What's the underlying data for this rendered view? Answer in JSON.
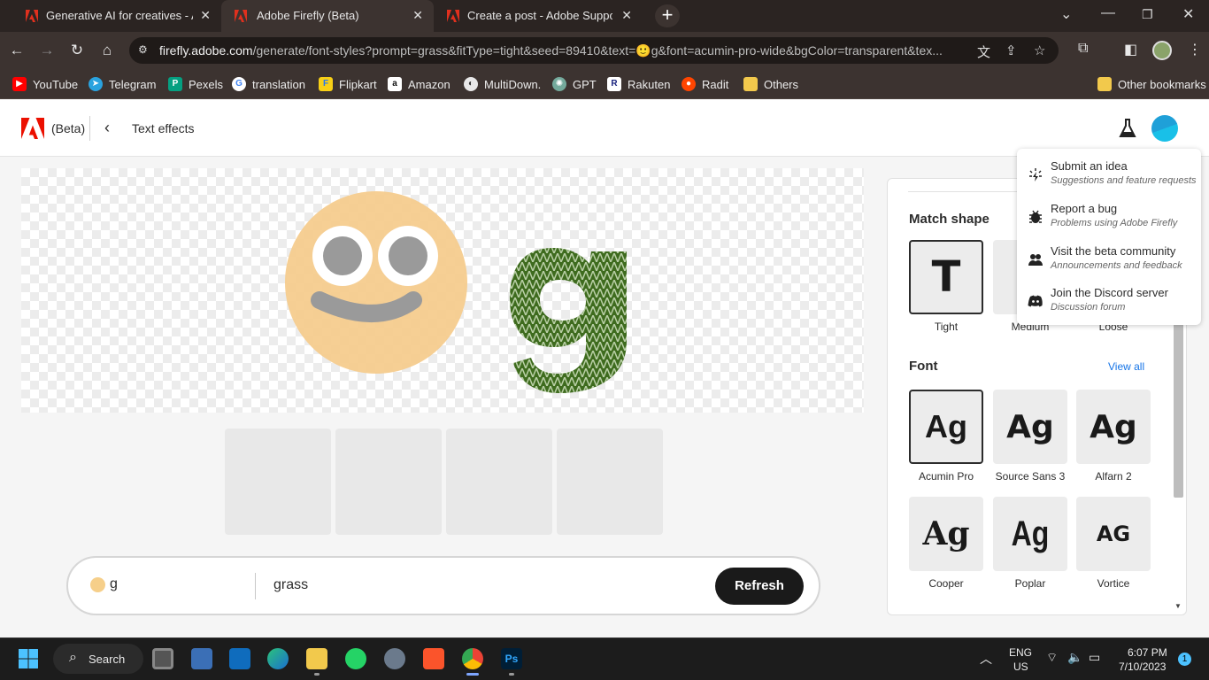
{
  "browser": {
    "tabs": [
      {
        "title": "Generative AI for creatives - Ad",
        "active": false
      },
      {
        "title": "Adobe Firefly (Beta)",
        "active": true
      },
      {
        "title": "Create a post - Adobe Support",
        "active": false
      }
    ],
    "url_domain": "firefly.adobe.com",
    "url_path": "/generate/font-styles?prompt=grass&fitType=tight&seed=89410&text=🙂g&font=acumin-pro-wide&bgColor=transparent&tex...",
    "bookmarks": [
      {
        "label": "YouTube",
        "color": "#ff0000"
      },
      {
        "label": "Telegram",
        "color": "#2aa3df"
      },
      {
        "label": "Pexels",
        "color": "#05a081"
      },
      {
        "label": "translation",
        "color": "#ffffff"
      },
      {
        "label": "Flipkart",
        "color": "#f8d016"
      },
      {
        "label": "Amazon",
        "color": "#ffffff"
      },
      {
        "label": "MultiDown.",
        "color": "#e8e8e8"
      },
      {
        "label": "GPT",
        "color": "#74aa9c"
      },
      {
        "label": "Rakuten",
        "color": "#ffffff"
      },
      {
        "label": "Radit",
        "color": "#ff4500"
      },
      {
        "label": "Others",
        "color": "#f2c94c"
      }
    ],
    "other_bookmarks": "Other bookmarks"
  },
  "app": {
    "beta_label": "(Beta)",
    "page_title": "Text effects",
    "accent": "#1473e6"
  },
  "prompt": {
    "text_value": "g",
    "prompt_value": "grass",
    "refresh_label": "Refresh"
  },
  "panel": {
    "match_shape_title": "Match shape",
    "shapes": [
      {
        "label": "Tight",
        "selected": true
      },
      {
        "label": "Medium",
        "selected": false
      },
      {
        "label": "Loose",
        "selected": false
      }
    ],
    "font_title": "Font",
    "view_all": "View all",
    "fonts": [
      {
        "label": "Acumin Pro",
        "glyph": "Ag",
        "selected": true
      },
      {
        "label": "Source Sans 3",
        "glyph": "Ag",
        "selected": false
      },
      {
        "label": "Alfarn 2",
        "glyph": "Ag",
        "selected": false
      },
      {
        "label": "Cooper",
        "glyph": "Ag",
        "selected": false
      },
      {
        "label": "Poplar",
        "glyph": "Ag",
        "selected": false
      },
      {
        "label": "Vortice",
        "glyph": "AG",
        "selected": false
      }
    ]
  },
  "menu": [
    {
      "title": "Submit an idea",
      "subtitle": "Suggestions and feature requests",
      "icon": "lightbulb-icon"
    },
    {
      "title": "Report a bug",
      "subtitle": "Problems using Adobe Firefly",
      "icon": "bug-icon"
    },
    {
      "title": "Visit the beta community",
      "subtitle": "Announcements and feedback",
      "icon": "community-icon"
    },
    {
      "title": "Join the Discord server",
      "subtitle": "Discussion forum",
      "icon": "discord-icon"
    }
  ],
  "taskbar": {
    "search_label": "Search",
    "lang_top": "ENG",
    "lang_bottom": "US",
    "time": "6:07 PM",
    "date": "7/10/2023",
    "notification_count": "1"
  }
}
